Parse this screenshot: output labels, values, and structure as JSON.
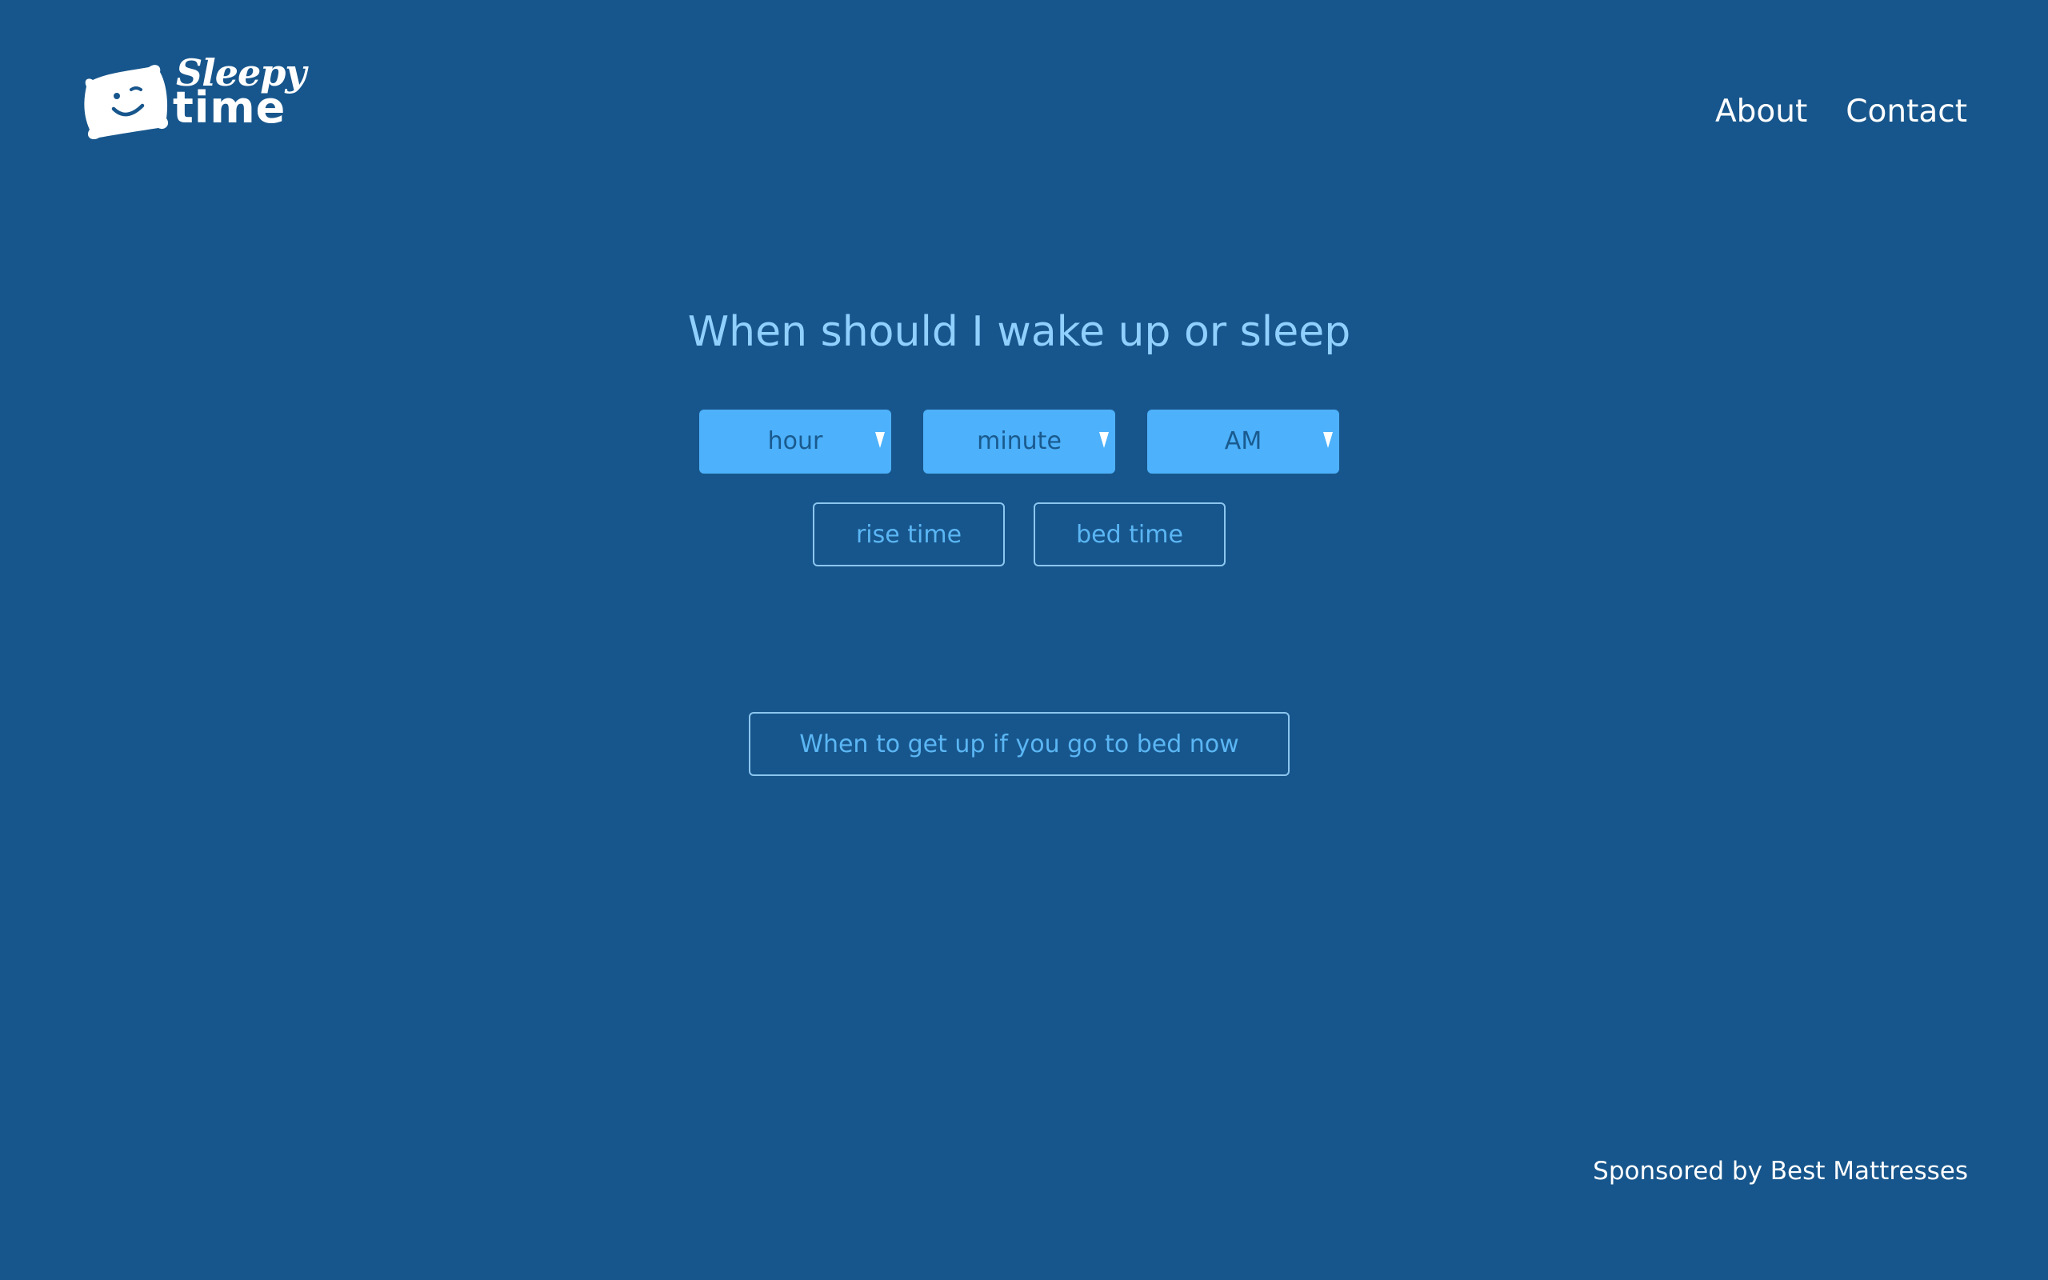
{
  "brand": {
    "logo_line1": "Sleepy",
    "logo_line2": "time",
    "logo_icon": "smiling-pillow-icon"
  },
  "nav": {
    "about": "About",
    "contact": "Contact"
  },
  "main": {
    "headline": "When should I wake up or sleep",
    "selects": {
      "hour": "hour",
      "minute": "minute",
      "period": "AM"
    },
    "buttons": {
      "rise": "rise time",
      "bed": "bed time",
      "now": "When to get up if you go to bed now"
    }
  },
  "footer": {
    "sponsor": "Sponsored by Best Mattresses"
  },
  "colors": {
    "background": "#17568c",
    "headline": "#8fd0ff",
    "select_bg": "#4db1fb",
    "button_border": "#8cc6f0",
    "button_text": "#5bb6f4"
  }
}
